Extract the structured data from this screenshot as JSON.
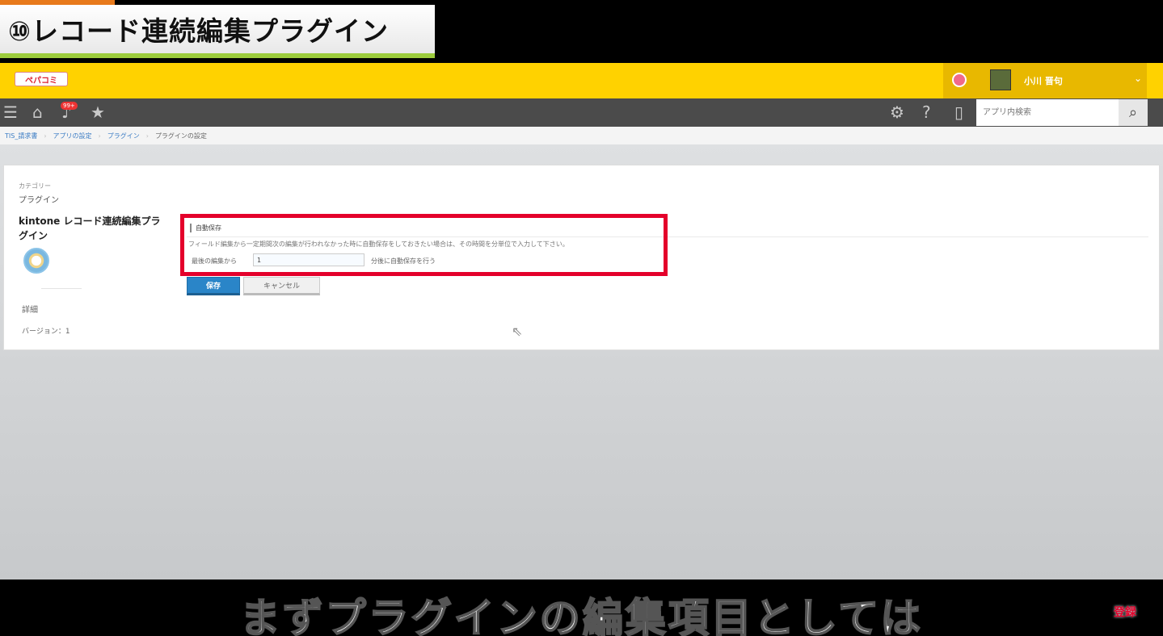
{
  "video": {
    "title": "⑩レコード連続編集プラグイン",
    "subtitle": "まずプラグインの編集項目としては",
    "subscribe_label": "登録"
  },
  "header": {
    "logo_text": "ペパコミ",
    "user_name": "小川 晋句",
    "search_placeholder": "アプリ内検索",
    "notification_badge": "99+"
  },
  "breadcrumb": [
    "TIS_請求書",
    "アプリの設定",
    "プラグイン",
    "プラグインの設定"
  ],
  "plugin": {
    "category_label": "カテゴリー",
    "category_value": "プラグイン",
    "name": "kintone レコード連続編集プラグイン",
    "detail_label": "詳細",
    "version_label": "バージョン：1"
  },
  "settings": {
    "section_title": "自動保存",
    "description": "フィールド編集から一定期間次の編集が行われなかった時に自動保存をしておきたい場合は、その時間を分単位で入力して下さい。",
    "field_label": "最後の編集から",
    "minutes_value": "1",
    "field_suffix": "分後に自動保存を行う",
    "save_label": "保存",
    "cancel_label": "キャンセル"
  },
  "colors": {
    "header_yellow": "#ffd200",
    "toolbar": "#4b4b4b",
    "highlight": "#e4002b",
    "primary_button": "#2a85c8"
  }
}
